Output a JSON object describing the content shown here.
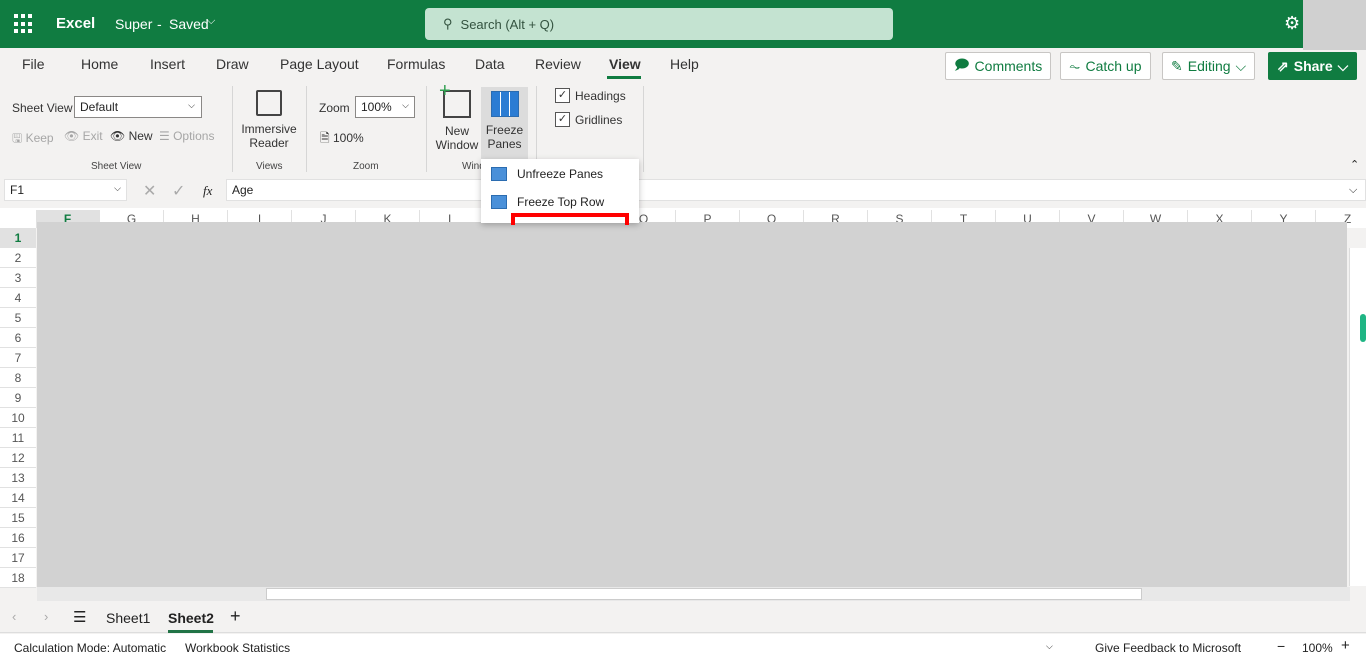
{
  "app": {
    "name": "Excel",
    "doc_title": "Super",
    "save_status": "Saved",
    "search_placeholder": "Search (Alt + Q)"
  },
  "tabs": [
    "File",
    "Home",
    "Insert",
    "Draw",
    "Page Layout",
    "Formulas",
    "Data",
    "Review",
    "View",
    "Help"
  ],
  "active_tab": "View",
  "actions": {
    "comments": "Comments",
    "catchup": "Catch up",
    "editing": "Editing",
    "share": "Share"
  },
  "ribbon": {
    "sheet_view": {
      "label": "Sheet View",
      "value": "Default",
      "keep": "Keep",
      "exit": "Exit",
      "new": "New",
      "options": "Options",
      "group": "Sheet View"
    },
    "views": {
      "immersive1": "Immersive",
      "immersive2": "Reader",
      "group": "Views"
    },
    "zoom": {
      "label": "Zoom",
      "value": "100%",
      "reset": "100%",
      "group": "Zoom"
    },
    "window": {
      "new1": "New",
      "new2": "Window",
      "freeze1": "Freeze",
      "freeze2": "Panes",
      "group": "Wind"
    },
    "show": {
      "headings": "Headings",
      "gridlines": "Gridlines",
      "headings_checked": true,
      "gridlines_checked": true
    }
  },
  "freeze_menu": [
    "Unfreeze Panes",
    "Freeze Top Row"
  ],
  "formula_bar": {
    "name_box": "F1",
    "fx": "fx",
    "value": "Age"
  },
  "columns": [
    "F",
    "G",
    "H",
    "I",
    "J",
    "K",
    "L",
    "M",
    "N",
    "O",
    "P",
    "Q",
    "R",
    "S",
    "T",
    "U",
    "V",
    "W",
    "X",
    "Y",
    "Z"
  ],
  "rows": [
    "1",
    "2",
    "3",
    "4",
    "5",
    "6",
    "7",
    "8",
    "9",
    "10",
    "11",
    "12",
    "13",
    "14",
    "15",
    "16",
    "17",
    "18"
  ],
  "sheets": [
    "Sheet1",
    "Sheet2"
  ],
  "active_sheet": "Sheet2",
  "status": {
    "calc": "Calculation Mode: Automatic",
    "stats": "Workbook Statistics",
    "feedback": "Give Feedback to Microsoft",
    "zoom": "100%"
  },
  "colors": {
    "brand": "#107c41",
    "highlight": "#ff0000"
  }
}
